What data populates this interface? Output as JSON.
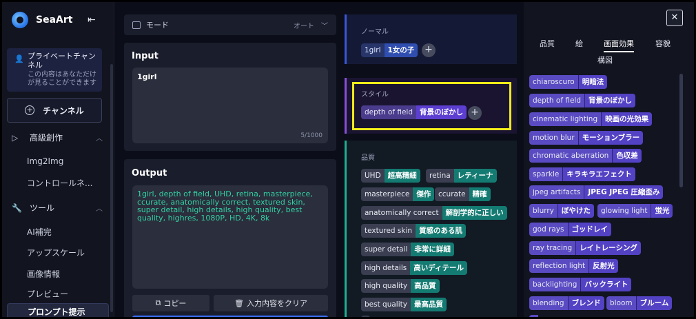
{
  "sidebar": {
    "brand": "SeaArt",
    "private_title": "プライベートチャンネル",
    "private_desc": "この内容はあなただけが見ることができます",
    "channel_label": "チャンネル",
    "section_advanced": "高級創作",
    "items_advanced": [
      "Img2Img",
      "コントロールネ..."
    ],
    "section_tools": "ツール",
    "items_tools": [
      "AI補完",
      "アップスケール",
      "画像情報",
      "プレビュー"
    ],
    "active_item": "プロンプト提示"
  },
  "mode": {
    "label": "モード",
    "value": "オート"
  },
  "input": {
    "title": "Input",
    "text": "1girl",
    "counter": "5/1000"
  },
  "output": {
    "title": "Output",
    "text": "1girl, depth of field, UHD, retina, masterpiece, ccurate, anatomically correct, textured skin, super detail, high details, high quality, best quality, highres, 1080P, HD, 4K, 8k",
    "copy_label": "コピー",
    "clear_label": "入力内容をクリア"
  },
  "normal": {
    "label": "ノーマル",
    "tags": [
      {
        "en": "1girl",
        "ja": "1女の子"
      }
    ]
  },
  "style": {
    "label": "スタイル",
    "tags": [
      {
        "en": "depth of field",
        "ja": "背景のぼかし"
      }
    ]
  },
  "quality": {
    "label": "品質",
    "tags": [
      {
        "en": "UHD",
        "ja": "超高精細"
      },
      {
        "en": "retina",
        "ja": "レティーナ"
      },
      {
        "en": "masterpiece",
        "ja": "傑作"
      },
      {
        "en": "ccurate",
        "ja": "精確"
      },
      {
        "en": "anatomically correct",
        "ja": "解剖学的に正しい"
      },
      {
        "en": "textured skin",
        "ja": "質感のある肌"
      },
      {
        "en": "super detail",
        "ja": "非常に詳細"
      },
      {
        "en": "high details",
        "ja": "高いディテール"
      },
      {
        "en": "high quality",
        "ja": "高品質"
      },
      {
        "en": "best quality",
        "ja": "最高品質"
      }
    ]
  },
  "right": {
    "tabs": [
      "品質",
      "絵",
      "画面効果",
      "容貌"
    ],
    "tab2": "構図",
    "active_tab": "画面効果",
    "tags": [
      {
        "en": "chiaroscuro",
        "ja": "明暗法"
      },
      {
        "en": "depth of field",
        "ja": "背景のぼかし"
      },
      {
        "en": "cinematic lighting",
        "ja": "映画の光効果"
      },
      {
        "en": "motion blur",
        "ja": "モーションブラー"
      },
      {
        "en": "chromatic aberration",
        "ja": "色収差"
      },
      {
        "en": "sparkle",
        "ja": "キラキラエフェクト"
      },
      {
        "en": "jpeg artifacts",
        "ja": "JPEG JPEG 圧縮歪み"
      },
      {
        "en": "blurry",
        "ja": "ぼやけた"
      },
      {
        "en": "glowing light",
        "ja": "蛍光"
      },
      {
        "en": "god rays",
        "ja": "ゴッドレイ"
      },
      {
        "en": "ray tracing",
        "ja": "レイトレーシング"
      },
      {
        "en": "reflection light",
        "ja": "反射光"
      },
      {
        "en": "backlighting",
        "ja": "バックライト"
      },
      {
        "en": "blending",
        "ja": "ブレンド"
      },
      {
        "en": "bloom",
        "ja": "ブルーム"
      }
    ]
  },
  "colors": {
    "accent_blue": "#3a6fff",
    "output_text": "#33d1a4",
    "highlight": "#f2ea19"
  }
}
